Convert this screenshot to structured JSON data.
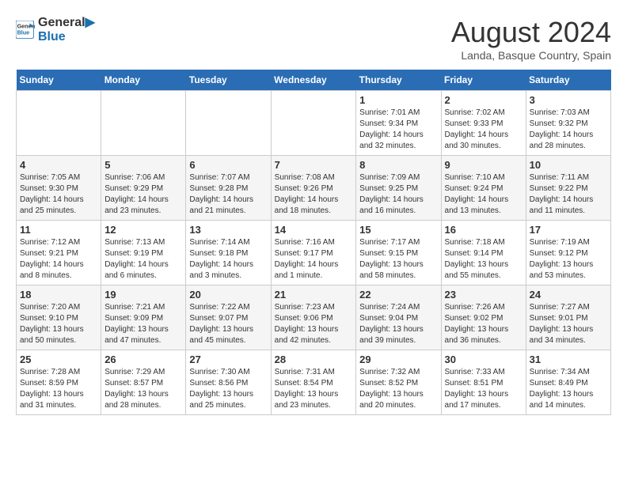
{
  "header": {
    "logo_line1": "General",
    "logo_line2": "Blue",
    "month_year": "August 2024",
    "location": "Landa, Basque Country, Spain"
  },
  "days_of_week": [
    "Sunday",
    "Monday",
    "Tuesday",
    "Wednesday",
    "Thursday",
    "Friday",
    "Saturday"
  ],
  "weeks": [
    [
      {
        "day": "",
        "info": ""
      },
      {
        "day": "",
        "info": ""
      },
      {
        "day": "",
        "info": ""
      },
      {
        "day": "",
        "info": ""
      },
      {
        "day": "1",
        "info": "Sunrise: 7:01 AM\nSunset: 9:34 PM\nDaylight: 14 hours\nand 32 minutes."
      },
      {
        "day": "2",
        "info": "Sunrise: 7:02 AM\nSunset: 9:33 PM\nDaylight: 14 hours\nand 30 minutes."
      },
      {
        "day": "3",
        "info": "Sunrise: 7:03 AM\nSunset: 9:32 PM\nDaylight: 14 hours\nand 28 minutes."
      }
    ],
    [
      {
        "day": "4",
        "info": "Sunrise: 7:05 AM\nSunset: 9:30 PM\nDaylight: 14 hours\nand 25 minutes."
      },
      {
        "day": "5",
        "info": "Sunrise: 7:06 AM\nSunset: 9:29 PM\nDaylight: 14 hours\nand 23 minutes."
      },
      {
        "day": "6",
        "info": "Sunrise: 7:07 AM\nSunset: 9:28 PM\nDaylight: 14 hours\nand 21 minutes."
      },
      {
        "day": "7",
        "info": "Sunrise: 7:08 AM\nSunset: 9:26 PM\nDaylight: 14 hours\nand 18 minutes."
      },
      {
        "day": "8",
        "info": "Sunrise: 7:09 AM\nSunset: 9:25 PM\nDaylight: 14 hours\nand 16 minutes."
      },
      {
        "day": "9",
        "info": "Sunrise: 7:10 AM\nSunset: 9:24 PM\nDaylight: 14 hours\nand 13 minutes."
      },
      {
        "day": "10",
        "info": "Sunrise: 7:11 AM\nSunset: 9:22 PM\nDaylight: 14 hours\nand 11 minutes."
      }
    ],
    [
      {
        "day": "11",
        "info": "Sunrise: 7:12 AM\nSunset: 9:21 PM\nDaylight: 14 hours\nand 8 minutes."
      },
      {
        "day": "12",
        "info": "Sunrise: 7:13 AM\nSunset: 9:19 PM\nDaylight: 14 hours\nand 6 minutes."
      },
      {
        "day": "13",
        "info": "Sunrise: 7:14 AM\nSunset: 9:18 PM\nDaylight: 14 hours\nand 3 minutes."
      },
      {
        "day": "14",
        "info": "Sunrise: 7:16 AM\nSunset: 9:17 PM\nDaylight: 14 hours\nand 1 minute."
      },
      {
        "day": "15",
        "info": "Sunrise: 7:17 AM\nSunset: 9:15 PM\nDaylight: 13 hours\nand 58 minutes."
      },
      {
        "day": "16",
        "info": "Sunrise: 7:18 AM\nSunset: 9:14 PM\nDaylight: 13 hours\nand 55 minutes."
      },
      {
        "day": "17",
        "info": "Sunrise: 7:19 AM\nSunset: 9:12 PM\nDaylight: 13 hours\nand 53 minutes."
      }
    ],
    [
      {
        "day": "18",
        "info": "Sunrise: 7:20 AM\nSunset: 9:10 PM\nDaylight: 13 hours\nand 50 minutes."
      },
      {
        "day": "19",
        "info": "Sunrise: 7:21 AM\nSunset: 9:09 PM\nDaylight: 13 hours\nand 47 minutes."
      },
      {
        "day": "20",
        "info": "Sunrise: 7:22 AM\nSunset: 9:07 PM\nDaylight: 13 hours\nand 45 minutes."
      },
      {
        "day": "21",
        "info": "Sunrise: 7:23 AM\nSunset: 9:06 PM\nDaylight: 13 hours\nand 42 minutes."
      },
      {
        "day": "22",
        "info": "Sunrise: 7:24 AM\nSunset: 9:04 PM\nDaylight: 13 hours\nand 39 minutes."
      },
      {
        "day": "23",
        "info": "Sunrise: 7:26 AM\nSunset: 9:02 PM\nDaylight: 13 hours\nand 36 minutes."
      },
      {
        "day": "24",
        "info": "Sunrise: 7:27 AM\nSunset: 9:01 PM\nDaylight: 13 hours\nand 34 minutes."
      }
    ],
    [
      {
        "day": "25",
        "info": "Sunrise: 7:28 AM\nSunset: 8:59 PM\nDaylight: 13 hours\nand 31 minutes."
      },
      {
        "day": "26",
        "info": "Sunrise: 7:29 AM\nSunset: 8:57 PM\nDaylight: 13 hours\nand 28 minutes."
      },
      {
        "day": "27",
        "info": "Sunrise: 7:30 AM\nSunset: 8:56 PM\nDaylight: 13 hours\nand 25 minutes."
      },
      {
        "day": "28",
        "info": "Sunrise: 7:31 AM\nSunset: 8:54 PM\nDaylight: 13 hours\nand 23 minutes."
      },
      {
        "day": "29",
        "info": "Sunrise: 7:32 AM\nSunset: 8:52 PM\nDaylight: 13 hours\nand 20 minutes."
      },
      {
        "day": "30",
        "info": "Sunrise: 7:33 AM\nSunset: 8:51 PM\nDaylight: 13 hours\nand 17 minutes."
      },
      {
        "day": "31",
        "info": "Sunrise: 7:34 AM\nSunset: 8:49 PM\nDaylight: 13 hours\nand 14 minutes."
      }
    ]
  ]
}
